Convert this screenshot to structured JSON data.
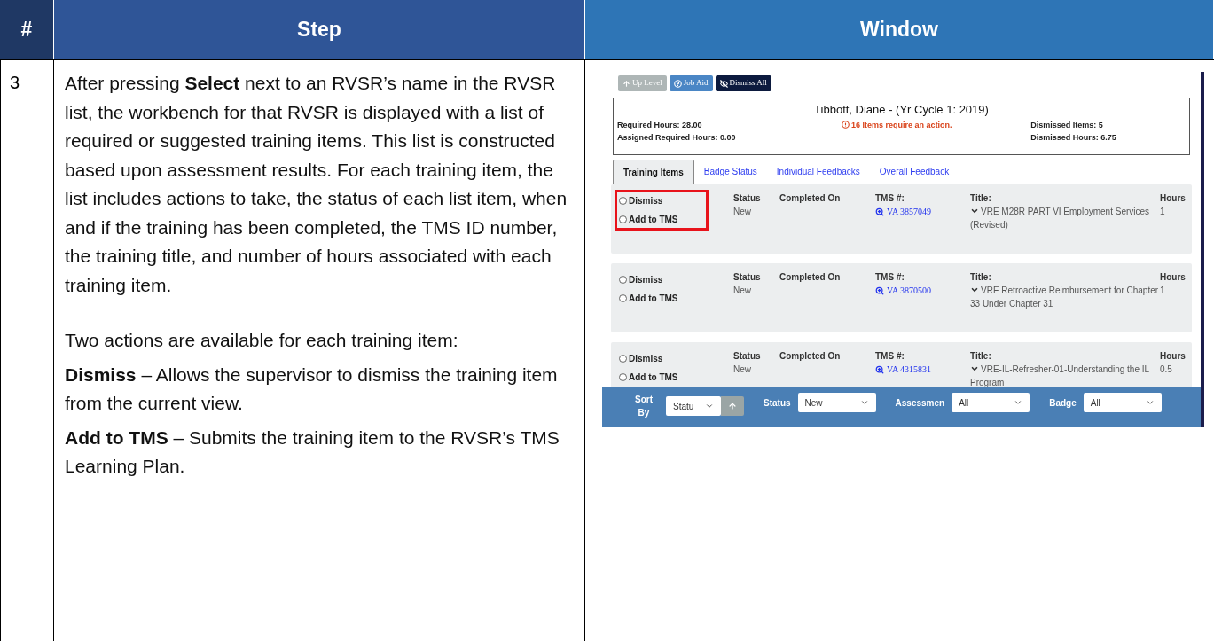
{
  "columns": [
    {
      "label": "#"
    },
    {
      "label": "Step"
    },
    {
      "label": "Window"
    }
  ],
  "row": {
    "number": "3",
    "paragraphs": [
      {
        "text": "After pressing **Select** next to an RVSR’s name in the RVSR list, the workbench for that RVSR is displayed with a list of required or suggested training items.  This list is constructed based upon assessment results.  For each training item, the list includes actions to take, the status of each list item, when and if the training has been completed, the TMS ID number, the training title, and number of hours associated with each training item."
      },
      {
        "text": "Two actions are available for each training item:"
      },
      {
        "text": "**Dismiss** – Allows the supervisor to dismiss the training item from the current view."
      },
      {
        "text": "**Add to TMS** – Submits the training item to the RVSR’s TMS Learning Plan."
      }
    ]
  },
  "window": {
    "toolbar": [
      {
        "label": "Up Level",
        "kind": "up",
        "disabled": true
      },
      {
        "label": "Job Aid",
        "kind": "help",
        "disabled": false
      },
      {
        "label": "Dismiss All",
        "kind": "dismiss",
        "disabled": false
      }
    ],
    "header": {
      "name": "Tibbott, Diane - (Yr Cycle 1: 2019)",
      "required_hours": "Required Hours: 28.00",
      "assigned_hours": "Assigned Required Hours: 0.00",
      "alert": "16 Items require an action.",
      "dismissed_items": "Dismissed Items: 5",
      "dismissed_hours": "Dismissed Hours: 6.75"
    },
    "tabs": [
      {
        "label": "Training Items",
        "selected": true
      },
      {
        "label": "Badge Status",
        "selected": false
      },
      {
        "label": "Individual Feedbacks",
        "selected": false
      },
      {
        "label": "Overall Feedback",
        "selected": false
      }
    ],
    "items": [
      {
        "highlighted": true,
        "actions": [
          {
            "label": "Dismiss",
            "selected": false
          },
          {
            "label": "Add to TMS",
            "selected": false
          }
        ],
        "labels": {
          "status": "Status",
          "completed": "Completed On",
          "tms": "TMS #:",
          "title": "Title:",
          "hours": "Hours"
        },
        "status": "New",
        "tms": "VA 3857049",
        "title": "VRE M28R PART VI Employment Services (Revised)",
        "hours": "1"
      },
      {
        "highlighted": false,
        "actions": [
          {
            "label": "Dismiss",
            "selected": false
          },
          {
            "label": "Add to TMS",
            "selected": false
          }
        ],
        "labels": {
          "status": "Status",
          "completed": "Completed On",
          "tms": "TMS #:",
          "title": "Title:",
          "hours": "Hours"
        },
        "status": "New",
        "tms": "VA 3870500",
        "title": "VRE Retroactive Reimbursement for Chapter 33 Under Chapter 31",
        "hours": "1"
      },
      {
        "highlighted": false,
        "actions": [
          {
            "label": "Dismiss",
            "selected": false
          },
          {
            "label": "Add to TMS",
            "selected": false
          }
        ],
        "labels": {
          "status": "Status",
          "completed": "Completed On",
          "tms": "TMS #:",
          "title": "Title:",
          "hours": "Hours"
        },
        "status": "New",
        "tms": "VA 4315831",
        "title": "VRE-IL-Refresher-01-Understanding the IL Program",
        "hours": "0.5"
      }
    ],
    "filters": [
      {
        "label": "Sort By",
        "value": "Statu",
        "kind": "sort"
      },
      {
        "label": "Status",
        "value": "New",
        "kind": "select"
      },
      {
        "label": "Assessmen",
        "value": "All",
        "kind": "select"
      },
      {
        "label": "Badge",
        "value": "All",
        "kind": "select"
      }
    ]
  }
}
